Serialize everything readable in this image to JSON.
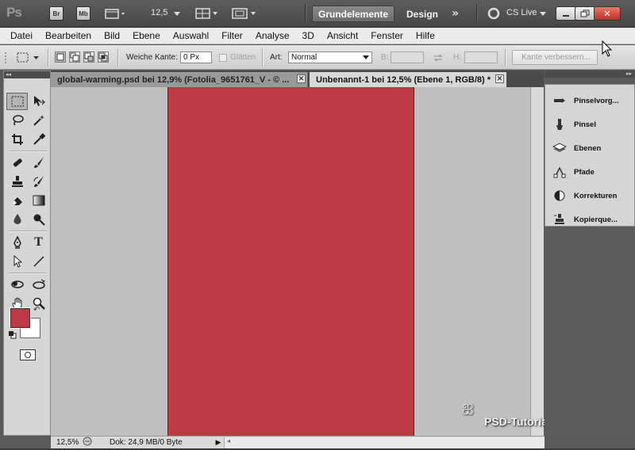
{
  "appbar": {
    "logo": "Ps",
    "bridge_label": "Br",
    "minibridge_label": "Mb",
    "zoom_value": "12,5",
    "workspaces": {
      "active": "Grundelemente",
      "other": "Design"
    },
    "cslive": "CS Live"
  },
  "menu": [
    "Datei",
    "Bearbeiten",
    "Bild",
    "Ebene",
    "Auswahl",
    "Filter",
    "Analyse",
    "3D",
    "Ansicht",
    "Fenster",
    "Hilfe"
  ],
  "options": {
    "feather_label": "Weiche Kante:",
    "feather_value": "0 Px",
    "antialias_label": "Glätten",
    "style_label": "Art:",
    "style_value": "Normal",
    "width_label": "B:",
    "height_label": "H:",
    "refine_button": "Kante verbessern..."
  },
  "tabs": [
    {
      "title": "global-warming.psd bei 12,9% (Fotolia_9651761_V - © ...",
      "active": false
    },
    {
      "title": "Unbenannt-1 bei 12,5% (Ebene 1, RGB/8) *",
      "active": true
    }
  ],
  "colors": {
    "foreground": "#bd3a42",
    "background": "#ffffff",
    "canvas_bg": "#c0c0c0"
  },
  "status": {
    "zoom": "12,5%",
    "doc_info": "Dok: 24,9 MB/0 Byte"
  },
  "dock": [
    {
      "label": "Pinselvorg...",
      "icon": "brush-presets-icon"
    },
    {
      "label": "Pinsel",
      "icon": "brush-icon"
    },
    {
      "label": "Ebenen",
      "icon": "layers-icon"
    },
    {
      "label": "Pfade",
      "icon": "paths-icon"
    },
    {
      "label": "Korrekturen",
      "icon": "adjustments-icon"
    },
    {
      "label": "Kopierque...",
      "icon": "clone-source-icon"
    }
  ],
  "watermark": "PSD-Tutorials.de"
}
